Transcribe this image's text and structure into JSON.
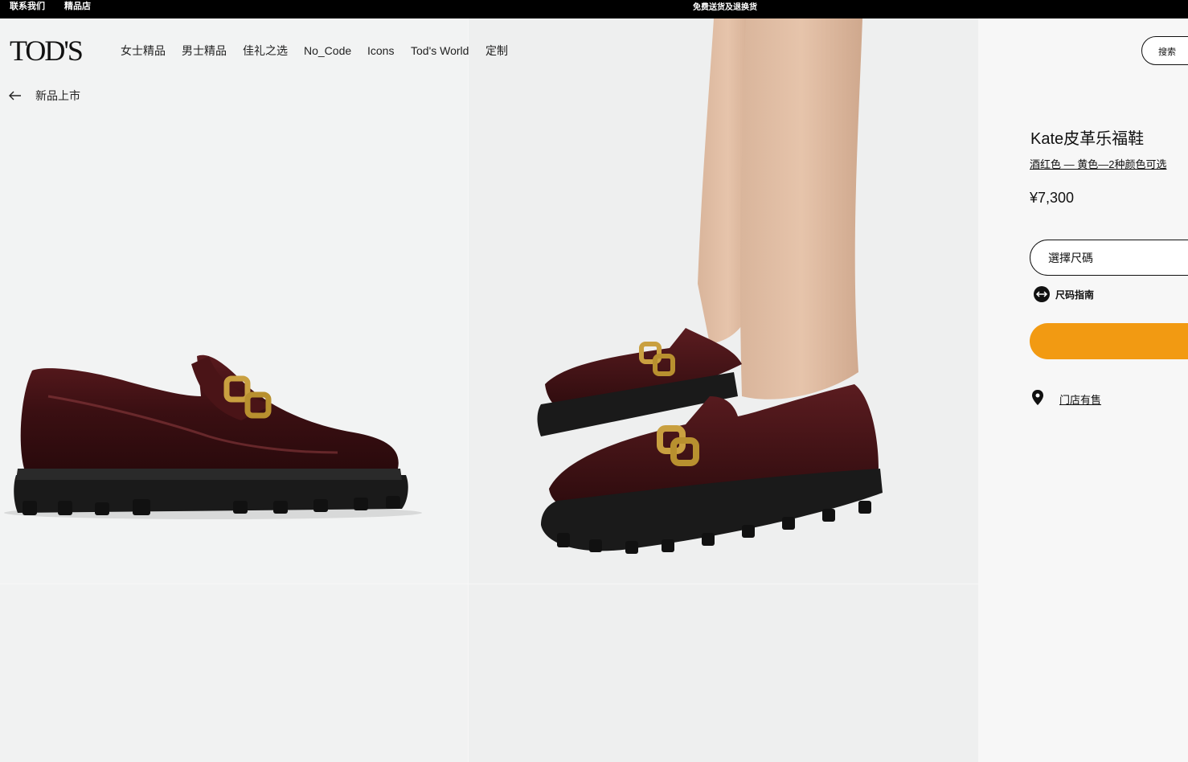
{
  "announcement": {
    "contact_label": "联系我们",
    "boutique_label": "精品店",
    "shipping_text": "免费送货及退换货"
  },
  "header": {
    "logo_text": "TOD'S",
    "nav": [
      {
        "label": "女士精品"
      },
      {
        "label": "男士精品"
      },
      {
        "label": "佳礼之选"
      },
      {
        "label": "No_Code"
      },
      {
        "label": "Icons"
      },
      {
        "label": "Tod's World"
      },
      {
        "label": "定制"
      }
    ],
    "search_label": "搜索"
  },
  "breadcrumb": {
    "back_label": "新品上市"
  },
  "product": {
    "title": "Kate皮革乐福鞋",
    "color_text": "酒红色 — 黄色—2种颜色可选",
    "price": "¥7,300",
    "size_placeholder": "選擇尺碼",
    "size_guide_label": "尺码指南",
    "store_label": "门店有售"
  },
  "colors": {
    "accent": "#f29a12",
    "topbar": "#000000",
    "leather": "#3a1214",
    "sole": "#1a1a1a",
    "buckle": "#c9a040"
  }
}
